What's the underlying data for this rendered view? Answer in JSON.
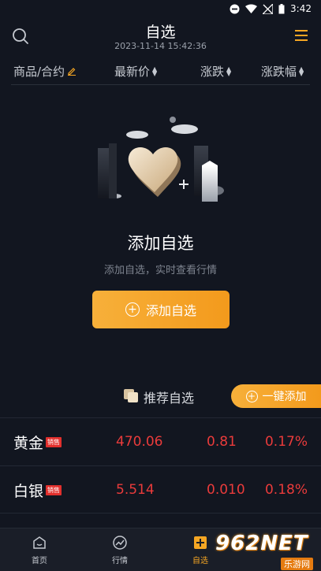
{
  "status_bar": {
    "time": "3:42"
  },
  "header": {
    "title": "自选",
    "datetime": "2023-11-14 15:42:36"
  },
  "columns": {
    "name": "商品/合约",
    "price": "最新价",
    "change": "涨跌",
    "pct": "涨跌幅"
  },
  "empty_state": {
    "title": "添加自选",
    "subtitle": "添加自选，实时查看行情",
    "button_label": "添加自选"
  },
  "recommend": {
    "label": "推荐自选",
    "one_click_label": "一键添加"
  },
  "items": [
    {
      "name": "黄金",
      "badge": "销售",
      "price": "470.06",
      "change": "0.81",
      "pct": "0.17%"
    },
    {
      "name": "白银",
      "badge": "销售",
      "price": "5.514",
      "change": "0.010",
      "pct": "0.18%"
    }
  ],
  "nav": {
    "home": "首页",
    "market": "行情",
    "watchlist": "自选"
  },
  "watermark": {
    "big": "962NET",
    "small": "乐游网"
  },
  "colors": {
    "accent": "#f5a623",
    "up": "#ea3b3b",
    "background": "#121620"
  }
}
